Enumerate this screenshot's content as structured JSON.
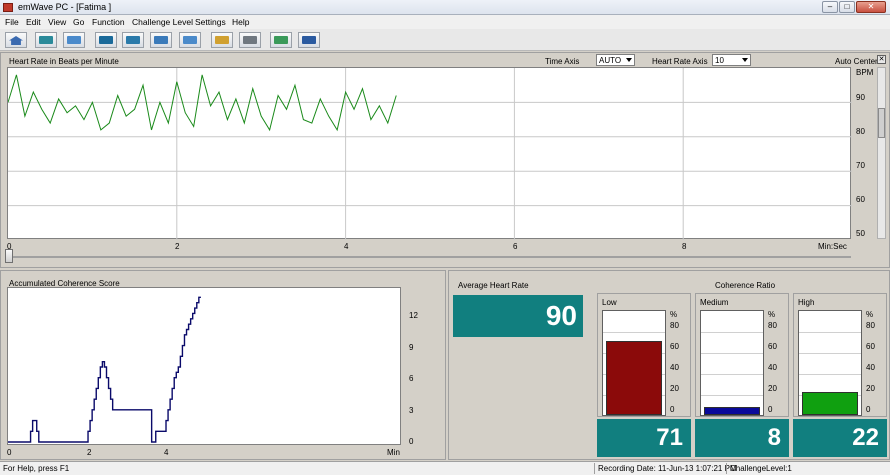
{
  "window": {
    "title": "emWave PC - [Fatima ]",
    "controls": {
      "minimize": "–",
      "maximize": "□",
      "close": "✕"
    }
  },
  "menu": [
    "File",
    "Edit",
    "View",
    "Go",
    "Function",
    "Challenge Level",
    "Settings",
    "Help"
  ],
  "toolbar": [
    "home-icon",
    "grid-chart-icon",
    "wave-chart-icon",
    "session-view-icon",
    "summary-view-icon",
    "spectrum-view-icon",
    "trend-view-icon",
    "open-folder-icon",
    "print-icon",
    "record-icon",
    "help-icon"
  ],
  "heart_rate": {
    "title": "Heart Rate in Beats per Minute",
    "time_axis_label": "Time Axis",
    "time_axis_value": "AUTO",
    "hr_axis_label": "Heart Rate Axis",
    "hr_axis_value": "10",
    "auto_center_label": "Auto Center",
    "bpm_label": "BPM",
    "y_ticks": [
      "90",
      "80",
      "70",
      "60",
      "50"
    ],
    "x_ticks": [
      "0",
      "2",
      "4",
      "6",
      "8"
    ],
    "x_unit": "Min:Sec",
    "line_color": "#1a8a1a"
  },
  "coherence": {
    "title": "Accumulated Coherence Score",
    "y_ticks": [
      "12",
      "9",
      "6",
      "3",
      "0"
    ],
    "x_ticks": [
      "0",
      "2",
      "4"
    ],
    "x_unit": "Min",
    "line_color": "#0a0a6a"
  },
  "avg_hr": {
    "label": "Average Heart Rate",
    "value": "90"
  },
  "coherence_ratio": {
    "label": "Coherence Ratio",
    "pct_label": "%",
    "scale": [
      "80",
      "60",
      "40",
      "20",
      "0"
    ],
    "boxes": [
      {
        "label": "Low",
        "value": "71",
        "fraction": 0.71,
        "color": "#8b0a0a"
      },
      {
        "label": "Medium",
        "value": "8",
        "fraction": 0.08,
        "color": "#0a0a9a"
      },
      {
        "label": "High",
        "value": "22",
        "fraction": 0.22,
        "color": "#10a010"
      }
    ]
  },
  "chart_data": [
    {
      "type": "line",
      "ylabel": "BPM",
      "ylim": [
        50,
        100
      ],
      "x": [
        0,
        0.1,
        0.2,
        0.3,
        0.4,
        0.5,
        0.6,
        0.7,
        0.8,
        0.9,
        1.0,
        1.1,
        1.2,
        1.3,
        1.4,
        1.5,
        1.6,
        1.7,
        1.8,
        1.9,
        2.0,
        2.1,
        2.2,
        2.3,
        2.4,
        2.5,
        2.6,
        2.7,
        2.8,
        2.9,
        3.0,
        3.1,
        3.2,
        3.3,
        3.4,
        3.5,
        3.6,
        3.7,
        3.8,
        3.9,
        4.0,
        4.1,
        4.2,
        4.3,
        4.4,
        4.5,
        4.6
      ],
      "series": [
        {
          "values": [
            90,
            98,
            86,
            93,
            88,
            84,
            91,
            87,
            89,
            85,
            90,
            82,
            84,
            92,
            86,
            88,
            95,
            82,
            90,
            84,
            96,
            87,
            83,
            98,
            89,
            93,
            85,
            91,
            84,
            94,
            86,
            82,
            92,
            88,
            95,
            85,
            84,
            91,
            86,
            82,
            93,
            88,
            94,
            85,
            89,
            84,
            92
          ]
        }
      ]
    },
    {
      "type": "line",
      "xlabel": "Min",
      "ylim": [
        0,
        14
      ],
      "x": [
        0,
        0.5,
        0.55,
        0.6,
        0.65,
        0.7,
        0.75,
        0.8,
        1.9,
        1.95,
        2.0,
        2.05,
        2.1,
        2.15,
        2.2,
        2.25,
        2.3,
        2.35,
        2.4,
        2.45,
        2.5,
        2.55,
        3.5,
        3.55,
        3.6,
        3.65,
        3.7,
        3.75,
        3.8,
        3.85,
        3.9,
        3.95,
        4.0,
        4.05,
        4.1,
        4.15,
        4.2,
        4.25,
        4.3,
        4.35,
        4.4,
        4.45,
        4.5,
        4.55,
        4.6,
        4.65,
        4.7
      ],
      "series": [
        {
          "values": [
            0,
            0,
            1,
            2,
            2,
            1,
            0,
            0,
            0,
            1,
            2,
            3,
            4,
            5,
            6,
            7,
            7.5,
            7,
            6,
            5,
            4,
            3,
            0,
            0,
            1,
            1,
            1,
            1,
            1,
            2,
            3,
            4,
            5,
            6,
            6.5,
            7,
            8,
            9,
            10,
            10.5,
            11,
            11.5,
            12,
            12.5,
            13,
            13.5,
            13.5
          ]
        }
      ]
    }
  ],
  "status": {
    "help": "For Help, press F1",
    "recording": "Recording Date: 11-Jun-13 1:07:21 PM",
    "challenge": "ChallengeLevel:1"
  }
}
